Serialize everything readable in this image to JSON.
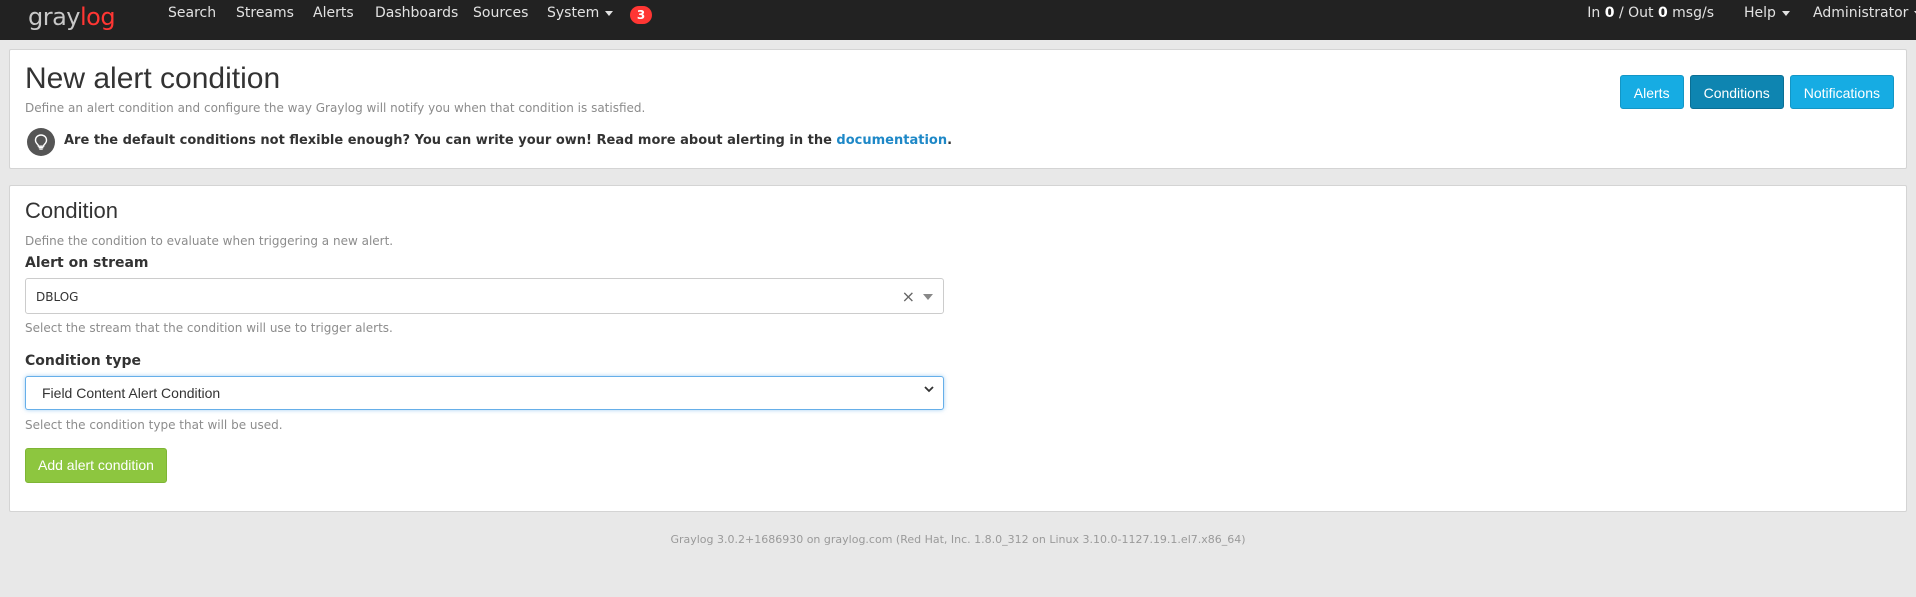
{
  "navbar": {
    "brand_part1": "gray",
    "brand_part2": "log",
    "links": [
      "Search",
      "Streams",
      "Alerts",
      "Dashboards",
      "Sources",
      "System"
    ],
    "notification_count": "3",
    "throughput_in_label": "In",
    "throughput_in": "0",
    "throughput_sep": "/ Out",
    "throughput_out": "0",
    "throughput_unit": "msg/s",
    "help": "Help",
    "user": "Administrator"
  },
  "header": {
    "title": "New alert condition",
    "subtitle": "Define an alert condition and configure the way Graylog will notify you when that condition is satisfied.",
    "tip": "Are the default conditions not flexible enough? You can write your own! Read more about alerting in the",
    "tip_link": "documentation",
    "tip_end": ".",
    "buttons": {
      "alerts": "Alerts",
      "conditions": "Conditions",
      "notifications": "Notifications"
    }
  },
  "condition": {
    "title": "Condition",
    "subtitle": "Define the condition to evaluate when triggering a new alert.",
    "stream_label": "Alert on stream",
    "stream_value": "DBLOG",
    "stream_help": "Select the stream that the condition will use to trigger alerts.",
    "type_label": "Condition type",
    "type_value": "Field Content Alert Condition",
    "type_help": "Select the condition type that will be used.",
    "add_button": "Add alert condition"
  },
  "footer": {
    "text": "Graylog 3.0.2+1686930 on graylog.com (Red Hat, Inc. 1.8.0_312 on Linux 3.10.0-1127.19.1.el7.x86_64)"
  },
  "colors": {
    "navbar": "#222222",
    "brand_red": "#ff3633",
    "primary_button": "#16ace3",
    "active_button": "#0e85b1",
    "success_button": "#8dc63f",
    "link": "#1e88c7"
  }
}
